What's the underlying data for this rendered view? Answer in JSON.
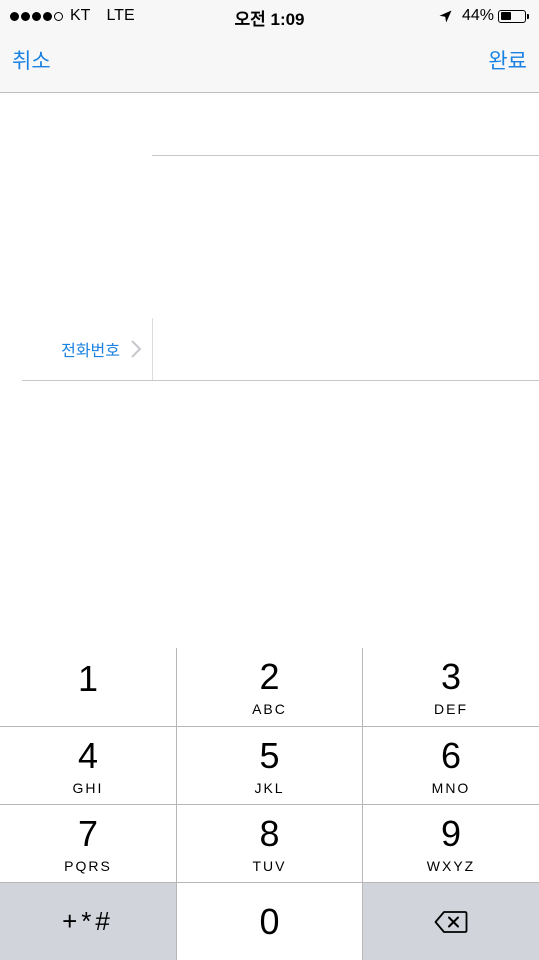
{
  "status_bar": {
    "signal_dots_filled": 4,
    "signal_dots_total": 5,
    "carrier": "KT",
    "network": "LTE",
    "time": "오전 1:09",
    "battery_percent": "44%",
    "battery_level": 0.44,
    "icons": [
      "signal-icon",
      "location-arrow-icon",
      "battery-icon"
    ]
  },
  "nav": {
    "cancel_label": "취소",
    "done_label": "완료",
    "accent_color": "#1a82e2"
  },
  "form": {
    "phone_label": "전화번호",
    "phone_value": ""
  },
  "keypad": {
    "keys": [
      {
        "digit": "1",
        "letters": ""
      },
      {
        "digit": "2",
        "letters": "ABC"
      },
      {
        "digit": "3",
        "letters": "DEF"
      },
      {
        "digit": "4",
        "letters": "GHI"
      },
      {
        "digit": "5",
        "letters": "JKL"
      },
      {
        "digit": "6",
        "letters": "MNO"
      },
      {
        "digit": "7",
        "letters": "PQRS"
      },
      {
        "digit": "8",
        "letters": "TUV"
      },
      {
        "digit": "9",
        "letters": "WXYZ"
      }
    ],
    "symbols_label": "+*#",
    "zero_digit": "0",
    "function_key_color": "#d2d4dc"
  }
}
